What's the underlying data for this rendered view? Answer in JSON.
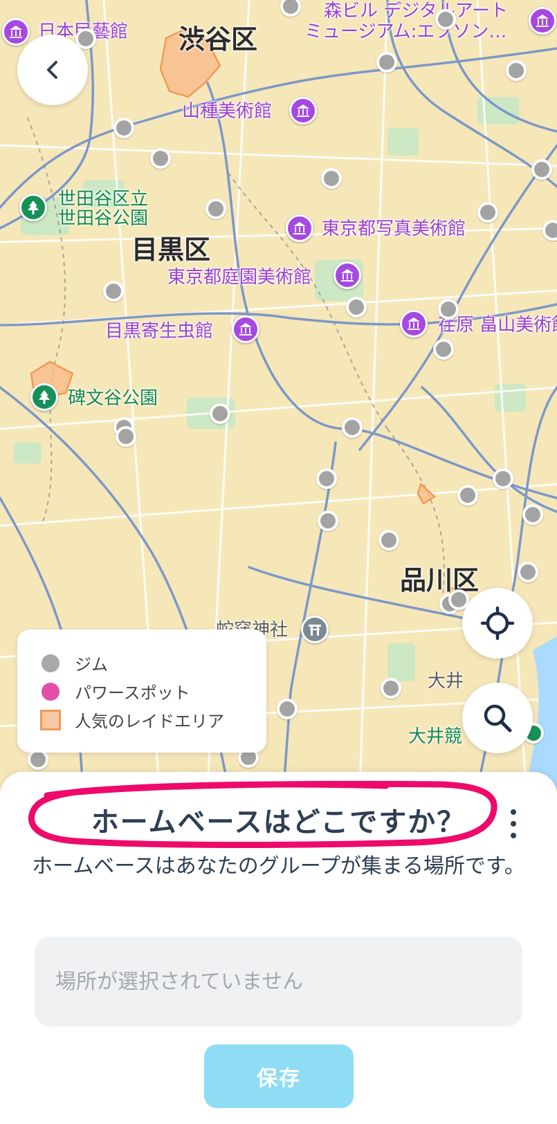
{
  "map": {
    "wards": [
      "渋谷区",
      "目黒区",
      "品川区"
    ],
    "museums": [
      "日本民藝館",
      "森ビル デジタルアート",
      "ミュージアム:エプソン…",
      "山種美術館",
      "東京都写真美術館",
      "東京都庭園美術館",
      "目黒寄生虫館",
      "荏原 畠山美術館"
    ],
    "parks": [
      "世田谷区立",
      "世田谷公園",
      "碑文谷公園",
      "大井競"
    ],
    "other": [
      "蛇窪神社",
      "大井"
    ]
  },
  "legend": {
    "gym": "ジム",
    "power_spot": "パワースポット",
    "raid_area": "人気のレイドエリア"
  },
  "sheet": {
    "title": "ホームベースはどこですか？",
    "description": "ホームベースはあなたのグループが集まる場所です。",
    "location_placeholder": "場所が選択されていません",
    "save_label": "保存"
  },
  "colors": {
    "map_background": "#f6e7b9",
    "road": "#7c98c9",
    "museum_pin": "#a649e0",
    "park_pin": "#16915a",
    "gym_dot": "#a3a3a3",
    "power_spot": "#e14fa6",
    "raid_area": "#f09a55",
    "highlight_ring": "#ee0a6a",
    "save_button": "#8fdcf5",
    "title_text": "#2f3e52"
  },
  "icons": {
    "back": "chevron-left-icon",
    "locate": "crosshair-icon",
    "search": "search-icon",
    "more": "more-vertical-icon",
    "museum": "museum-icon",
    "park": "tree-icon",
    "shrine": "torii-icon"
  }
}
